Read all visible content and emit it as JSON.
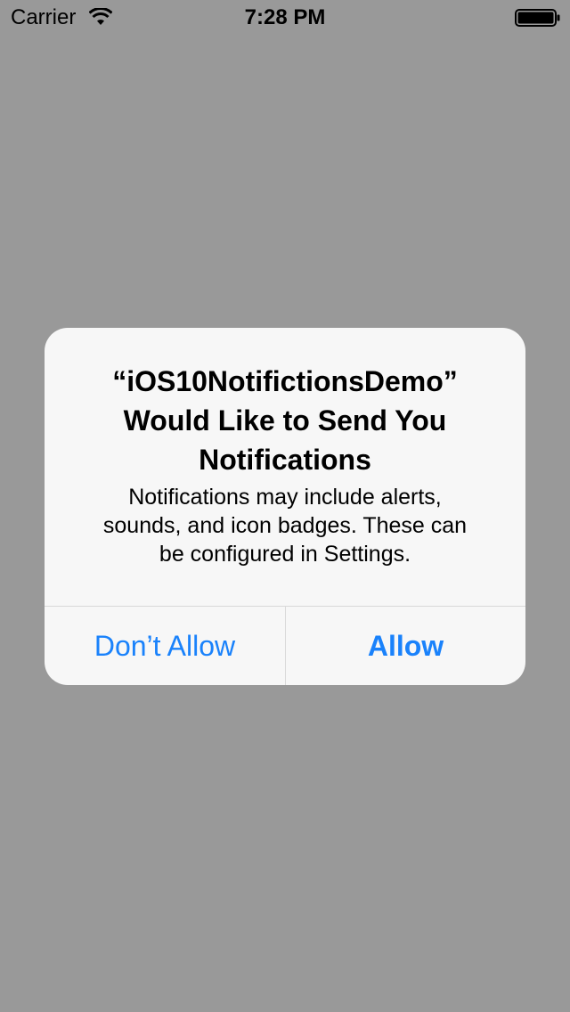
{
  "status_bar": {
    "carrier": "Carrier",
    "time": "7:28 PM",
    "wifi_icon": "wifi-icon",
    "battery_icon": "battery-full-icon"
  },
  "alert": {
    "title_line1": "“iOS10NotifictionsDemo”",
    "title_line2": "Would Like to Send You",
    "title_line3": "Notifications",
    "message_line1": "Notifications may include alerts,",
    "message_line2": "sounds, and icon badges. These can",
    "message_line3": "be configured in Settings.",
    "dont_allow_label": "Don’t Allow",
    "allow_label": "Allow"
  },
  "colors": {
    "background_dim": "#999999",
    "alert_background": "#f7f7f7",
    "button_tint": "#1a82fb"
  }
}
